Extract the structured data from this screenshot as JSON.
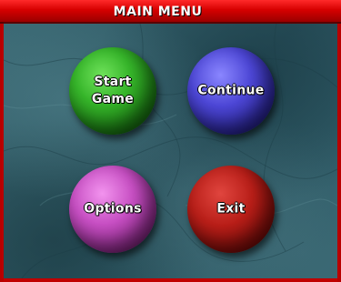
{
  "window": {
    "title": "MAIN MENU",
    "accent_color": "#c80000"
  },
  "menu": {
    "items": [
      {
        "label": "Start\nGame",
        "color": "#2a9a1e",
        "icon": "green-sphere"
      },
      {
        "label": "Continue",
        "color": "#3d37c2",
        "icon": "blue-sphere"
      },
      {
        "label": "Options",
        "color": "#b43db0",
        "icon": "magenta-sphere"
      },
      {
        "label": "Exit",
        "color": "#a01510",
        "icon": "red-sphere"
      }
    ]
  },
  "background": {
    "texture": "teal-marble",
    "color": "#2f5a66"
  }
}
